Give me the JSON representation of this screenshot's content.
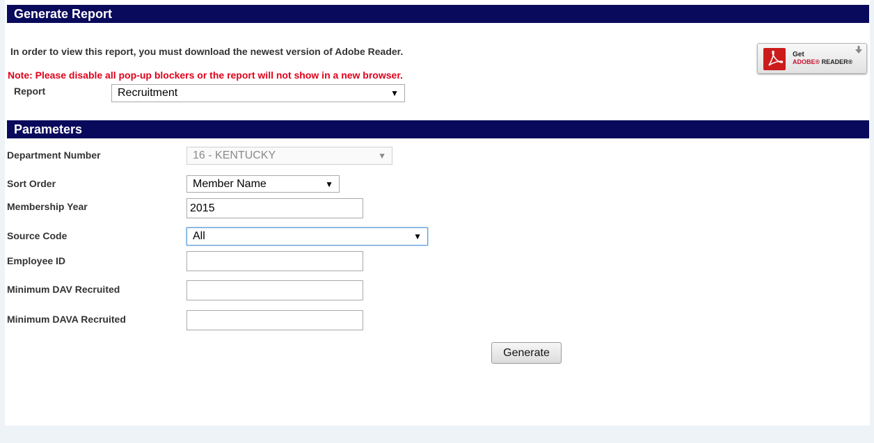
{
  "header": {
    "title": "Generate Report"
  },
  "info_text": "In order to view this report, you must download the newest version of Adobe Reader.",
  "note_text": "Note: Please disable all pop-up blockers or the report will not show in a new browser.",
  "report": {
    "label": "Report",
    "selected": "Recruitment"
  },
  "adobe_badge": {
    "get": "Get",
    "brand": "ADOBE",
    "reg1": "®",
    "product": " READER",
    "reg2": "®"
  },
  "parameters": {
    "title": "Parameters",
    "department": {
      "label": "Department Number",
      "selected": "16 - KENTUCKY"
    },
    "sort_order": {
      "label": "Sort Order",
      "selected": "Member Name"
    },
    "membership_year": {
      "label": "Membership Year",
      "value": "2015"
    },
    "source_code": {
      "label": "Source Code",
      "selected": "All"
    },
    "employee_id": {
      "label": "Employee ID",
      "value": ""
    },
    "min_dav": {
      "label": "Minimum DAV Recruited",
      "value": ""
    },
    "min_dava": {
      "label": "Minimum DAVA Recruited",
      "value": ""
    }
  },
  "generate_button": {
    "label": "Generate"
  },
  "colors": {
    "header_bg": "#0a0a5c",
    "note": "#e0001a",
    "adobe_red": "#cc1b1b"
  },
  "icons": {
    "dropdown": "▼",
    "download": "download-arrow-icon"
  }
}
